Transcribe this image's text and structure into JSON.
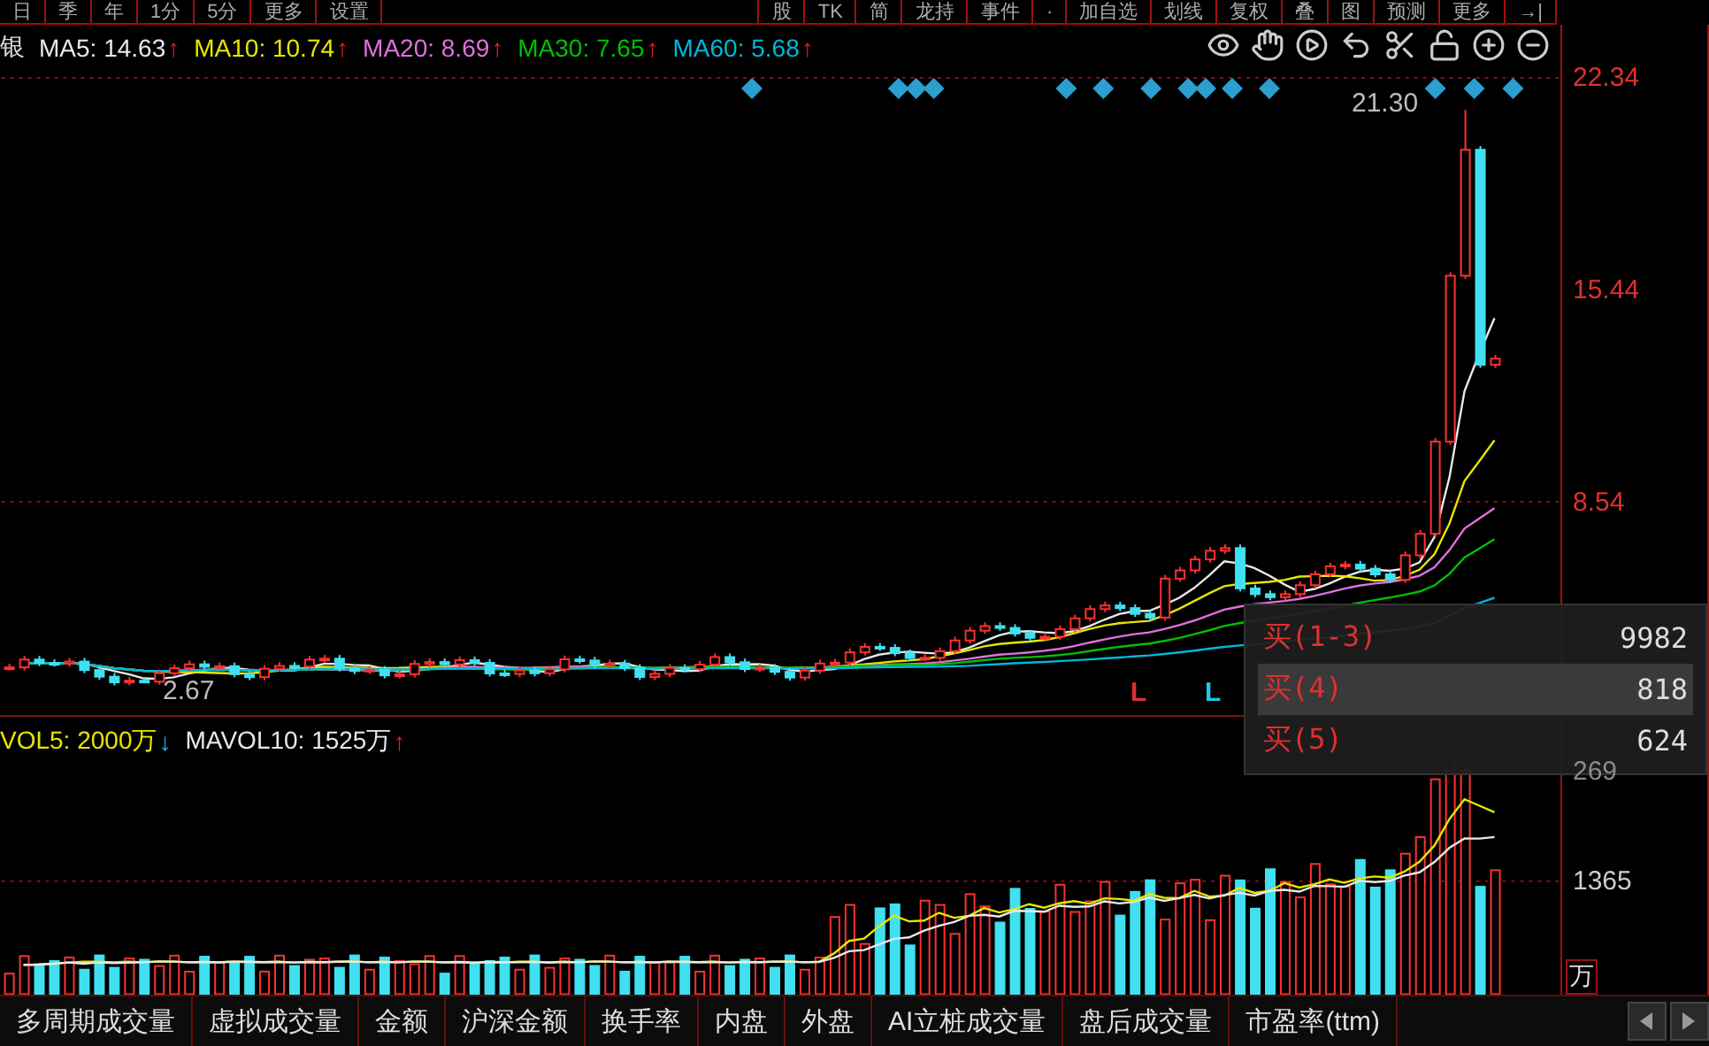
{
  "toolbar": {
    "left": [
      "日",
      "季",
      "年",
      "1分",
      "5分",
      "更多",
      "设置"
    ],
    "right": [
      "股",
      "TK",
      "简",
      "龙持",
      "事件",
      "·",
      "加自选",
      "划线",
      "复权",
      "叠",
      "图",
      "预测",
      "更多",
      "→|"
    ]
  },
  "ma_legend": {
    "name": "银",
    "items": [
      {
        "label": "MA5:",
        "value": "14.63",
        "color": "#e8e8e8",
        "arrow": {
          "text": "↑",
          "color": "#e02020"
        }
      },
      {
        "label": "MA10:",
        "value": "10.74",
        "color": "#e6e600",
        "arrow": {
          "text": "↑",
          "color": "#e02020"
        }
      },
      {
        "label": "MA20:",
        "value": "8.69",
        "color": "#e070e0",
        "arrow": {
          "text": "↑",
          "color": "#e02020"
        }
      },
      {
        "label": "MA30:",
        "value": "7.65",
        "color": "#00c000",
        "arrow": {
          "text": "↑",
          "color": "#e02020"
        }
      },
      {
        "label": "MA60:",
        "value": "5.68",
        "color": "#00b8d8",
        "arrow": {
          "text": "↑",
          "color": "#e02020"
        }
      }
    ]
  },
  "price_annotations": [
    {
      "kind": "high",
      "text": "21.30"
    },
    {
      "kind": "low",
      "text": "2.67"
    }
  ],
  "signals": [
    {
      "text": "L",
      "color": "#e03030"
    },
    {
      "text": "L",
      "color": "#20c8e8"
    }
  ],
  "price_axis": [
    "22.34",
    "15.44",
    "8.54"
  ],
  "vol_legend": [
    {
      "label": "VOL5:",
      "value": "2000万",
      "color": "#e6e600",
      "arrow": {
        "text": "↓",
        "color": "#20b8e0"
      }
    },
    {
      "label": "MAVOL10:",
      "value": "1525万",
      "color": "#e8e8e8",
      "arrow": {
        "text": "↑",
        "color": "#e02020"
      }
    }
  ],
  "volume_axis": [
    "269",
    "1365"
  ],
  "volume_unit": "万",
  "popup": [
    {
      "label": "买(1-3)",
      "value": "9982",
      "selected": false
    },
    {
      "label": "买(4)",
      "value": "818",
      "selected": true
    },
    {
      "label": "买(5)",
      "value": "624",
      "selected": false
    }
  ],
  "tabs": [
    "多周期成交量",
    "虚拟成交量",
    "金额",
    "沪深金额",
    "换手率",
    "内盘",
    "外盘",
    "AI立桩成交量",
    "盘后成交量",
    "市盈率(ttm)"
  ]
}
